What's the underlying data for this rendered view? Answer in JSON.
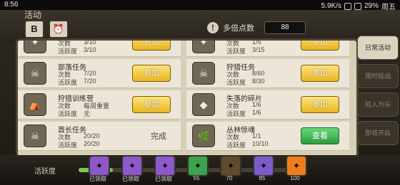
{
  "status": {
    "time": "8:56",
    "right_text": "5.9K/s",
    "battery": "29%",
    "day": "周五"
  },
  "header": {
    "title": "活动",
    "multiplier_label": "多倍点数",
    "multiplier_value": "88"
  },
  "tasks": [
    {
      "name": "",
      "count_label": "次数",
      "count": "3/10",
      "act_label": "活跃度",
      "act": "3/10",
      "action": "参加",
      "state": "join"
    },
    {
      "name": "",
      "count_label": "次数",
      "count": "1/5",
      "act_label": "活跃度",
      "act": "3/15",
      "action": "参加",
      "state": "join"
    },
    {
      "name": "部落任务",
      "count_label": "次数",
      "count": "7/20",
      "act_label": "活跃度",
      "act": "7/20",
      "action": "参加",
      "state": "join"
    },
    {
      "name": "狩猎任务",
      "count_label": "次数",
      "count": "8/60",
      "act_label": "活跃度",
      "act": "8/30",
      "action": "参加",
      "state": "join"
    },
    {
      "name": "狩猎训练营",
      "count_label": "次数",
      "count": "每周重置",
      "act_label": "活跃度",
      "act": "无",
      "action": "参加",
      "state": "join"
    },
    {
      "name": "失落的碎片",
      "count_label": "次数",
      "count": "1/6",
      "act_label": "活跃度",
      "act": "1/6",
      "action": "参加",
      "state": "join"
    },
    {
      "name": "酋长任务",
      "count_label": "次数",
      "count": "20/20",
      "act_label": "活跃度",
      "act": "20/20",
      "action": "完成",
      "state": "done"
    },
    {
      "name": "丛林惊魂",
      "count_label": "次数",
      "count": "1/1",
      "act_label": "活跃度",
      "act": "10/10",
      "action": "查看",
      "state": "view"
    }
  ],
  "side_tabs": [
    "日常活动",
    "限时抵战",
    "陷入为乐",
    "即将开启"
  ],
  "bottom": {
    "label": "活跃度",
    "progress_fraction": 0.15,
    "badge": "51",
    "rewards": [
      {
        "caption": "已领取",
        "color": "#8f57c7"
      },
      {
        "caption": "已领取",
        "color": "#8f57c7"
      },
      {
        "caption": "已领取",
        "color": "#8f57c7"
      },
      {
        "caption": "55",
        "color": "#3da34d"
      },
      {
        "caption": "70",
        "color": "#5f4a2b"
      },
      {
        "caption": "85",
        "color": "#7d5ac7"
      },
      {
        "caption": "100",
        "color": "#f07d1b"
      }
    ]
  }
}
